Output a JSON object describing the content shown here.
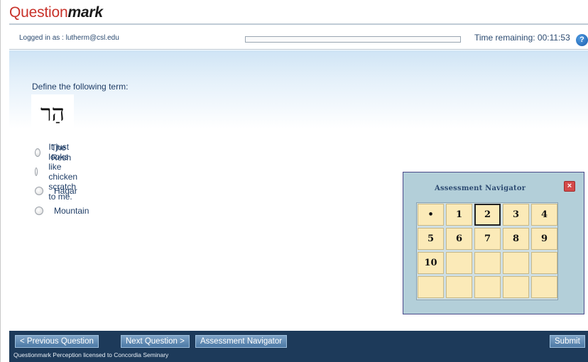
{
  "brand": {
    "logo_plain": "Question",
    "logo_bold": "mark"
  },
  "status": {
    "logged_in": "Logged in as : lutherm@csl.edu",
    "progress": 0,
    "time_remaining": "Time remaining: 00:11:53",
    "help_icon": "?"
  },
  "question": {
    "prompt": "Define the following term:",
    "term": "הַר",
    "choices": [
      {
        "label": "The Resh",
        "selected": false
      },
      {
        "label": "It just looks like chicken scratch to me.",
        "selected": false
      },
      {
        "label": "Hagar",
        "selected": false
      },
      {
        "label": "Mountain",
        "selected": false
      }
    ]
  },
  "navigator": {
    "title": "Assessment Navigator",
    "close_icon": "×",
    "current_question": 2,
    "cells": [
      "•",
      "1",
      "2",
      "3",
      "4",
      "5",
      "6",
      "7",
      "8",
      "9",
      "10",
      "",
      "",
      "",
      "",
      "",
      "",
      "",
      "",
      ""
    ]
  },
  "footer": {
    "prev_label": "< Previous Question",
    "next_label": "Next Question >",
    "navigator_label": "Assessment Navigator",
    "submit_label": "Submit",
    "license_text": "Questionmark Perception licensed to Concordia Seminary"
  },
  "colors": {
    "brand_red": "#c8322a",
    "footer_bg": "#1d3a5a",
    "navigator_bg": "#b3cfd9",
    "cell_bg": "#fbeab8"
  }
}
